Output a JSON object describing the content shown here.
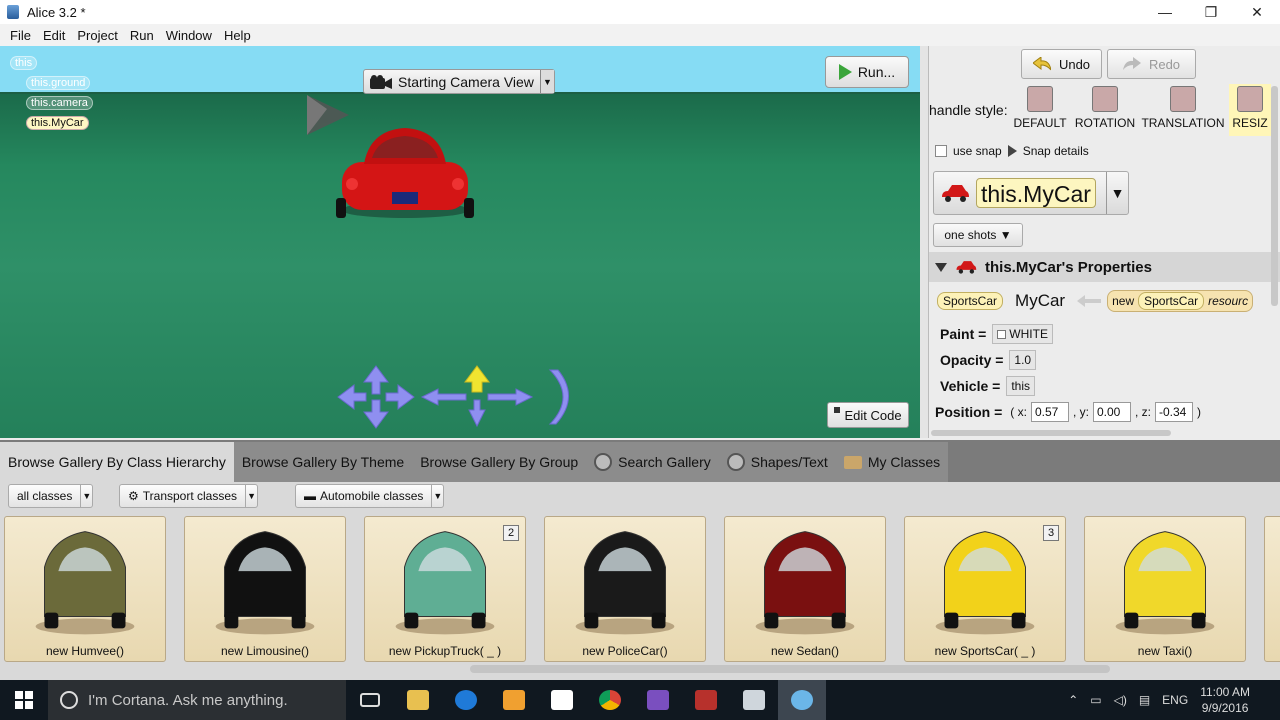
{
  "window": {
    "title": "Alice 3.2 *",
    "controls": [
      "—",
      "❐",
      "✕"
    ]
  },
  "menu": [
    "File",
    "Edit",
    "Project",
    "Run",
    "Window",
    "Help"
  ],
  "scene": {
    "tree": [
      {
        "label": "this",
        "selected": false
      },
      {
        "label": "this.ground",
        "selected": false
      },
      {
        "label": "this.camera",
        "selected": false
      },
      {
        "label": "this.MyCar",
        "selected": true
      }
    ],
    "camera_view": "Starting Camera View",
    "run_label": "Run...",
    "edit_code_label": "Edit Code"
  },
  "right_panel": {
    "undo": "Undo",
    "redo": "Redo",
    "handle_style_label": "handle style:",
    "handle_styles": [
      "DEFAULT",
      "ROTATION",
      "TRANSLATION",
      "RESIZ"
    ],
    "active_handle_style": "RESIZ",
    "use_snap": "use snap",
    "snap_details": "Snap details",
    "selected_object": "this.MyCar",
    "one_shots": "one shots",
    "properties_title": "this.MyCar's Properties",
    "type_pill": "SportsCar",
    "type_name": "MyCar",
    "new_label": "new",
    "new_type": "SportsCar",
    "resource_label": "resourc",
    "properties": [
      {
        "name": "Paint =",
        "value": "WHITE"
      },
      {
        "name": "Opacity =",
        "value": "1.0"
      },
      {
        "name": "Vehicle =",
        "value": "this"
      }
    ],
    "position": {
      "label": "Position =",
      "x_label": "( x:",
      "x": "0.57",
      "y_label": ", y:",
      "y": "0.00",
      "z_label": ", z:",
      "z": "-0.34",
      "close": ")"
    }
  },
  "gallery": {
    "tabs": [
      {
        "label": "Browse Gallery By Class Hierarchy",
        "active": true
      },
      {
        "label": "Browse Gallery By Theme",
        "active": false
      },
      {
        "label": "Browse Gallery By Group",
        "active": false
      },
      {
        "label": "Search Gallery",
        "active": false
      },
      {
        "label": "Shapes/Text",
        "active": false
      },
      {
        "label": "My Classes",
        "active": false
      }
    ],
    "breadcrumbs": [
      "all classes",
      "Transport classes",
      "Automobile classes"
    ],
    "cards": [
      {
        "label": "new Humvee()",
        "badge": "",
        "color": "#6b6a3a"
      },
      {
        "label": "new Limousine()",
        "badge": "",
        "color": "#111111"
      },
      {
        "label": "new PickupTruck( _ )",
        "badge": "2",
        "color": "#5fae94"
      },
      {
        "label": "new PoliceCar()",
        "badge": "",
        "color": "#1a1a1a"
      },
      {
        "label": "new Sedan()",
        "badge": "",
        "color": "#7a1010"
      },
      {
        "label": "new SportsCar( _ )",
        "badge": "3",
        "color": "#f2d21a"
      },
      {
        "label": "new Taxi()",
        "badge": "",
        "color": "#f0d82a"
      }
    ]
  },
  "taskbar": {
    "search_placeholder": "I'm Cortana. Ask me anything.",
    "language": "ENG",
    "time": "11:00 AM",
    "date": "9/9/2016"
  }
}
